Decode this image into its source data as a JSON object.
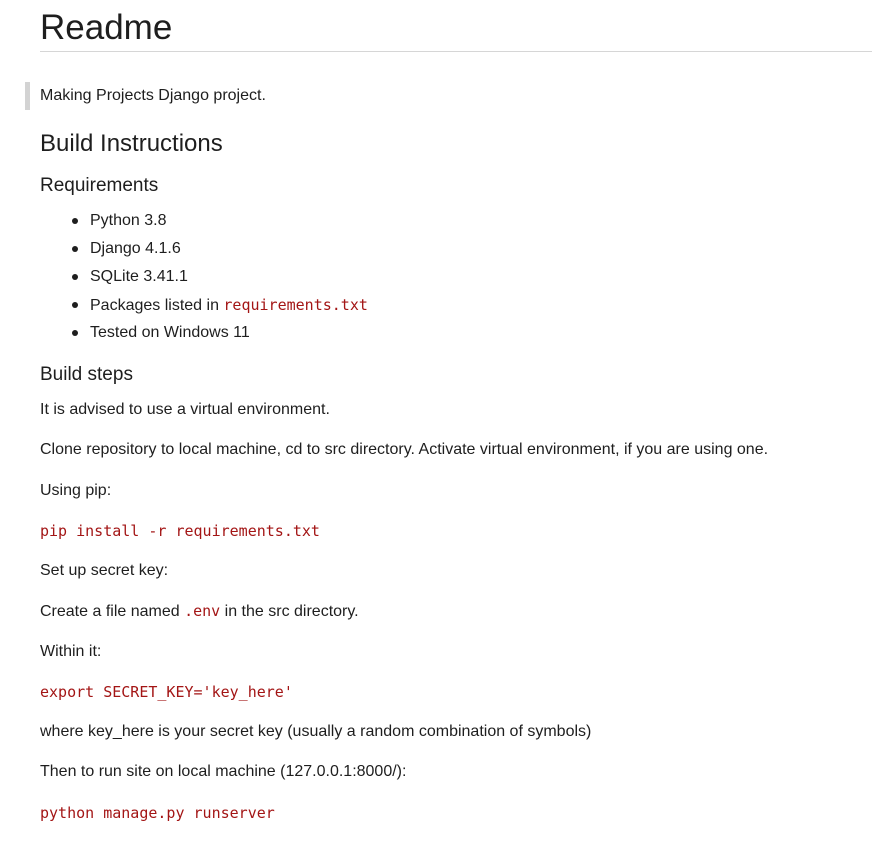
{
  "title": "Readme",
  "intro": "Making Projects Django project.",
  "build_instructions": {
    "heading": "Build Instructions",
    "requirements": {
      "heading": "Requirements",
      "items": [
        {
          "text": "Python 3.8"
        },
        {
          "text": "Django 4.1.6"
        },
        {
          "text": "SQLite 3.41.1"
        },
        {
          "text": "Packages listed in ",
          "code": "requirements.txt"
        },
        {
          "text": "Tested on Windows 11"
        }
      ]
    },
    "build_steps": {
      "heading": "Build steps",
      "advice": "It is advised to use a virtual environment.",
      "clone": "Clone repository to local machine, cd to src directory. Activate virtual environment, if you are using one.",
      "using_pip": "Using pip:",
      "pip_cmd": "pip install -r requirements.txt",
      "secret_key_intro": "Set up secret key:",
      "create_file_pre": "Create a file named ",
      "create_file_code": ".env",
      "create_file_post": " in the src directory.",
      "within_it": "Within it:",
      "export_cmd": "export SECRET_KEY='key_here'",
      "key_note": "where key_here is your secret key (usually a random combination of symbols)",
      "run_intro": "Then to run site on local machine (127.0.0.1:8000/):",
      "run_cmd": "python manage.py runserver"
    }
  },
  "colors": {
    "code_text": "#a31515",
    "body_text": "#1e1e1e",
    "rule": "#d6d6d6",
    "quote_bar": "#d3d3d3"
  }
}
